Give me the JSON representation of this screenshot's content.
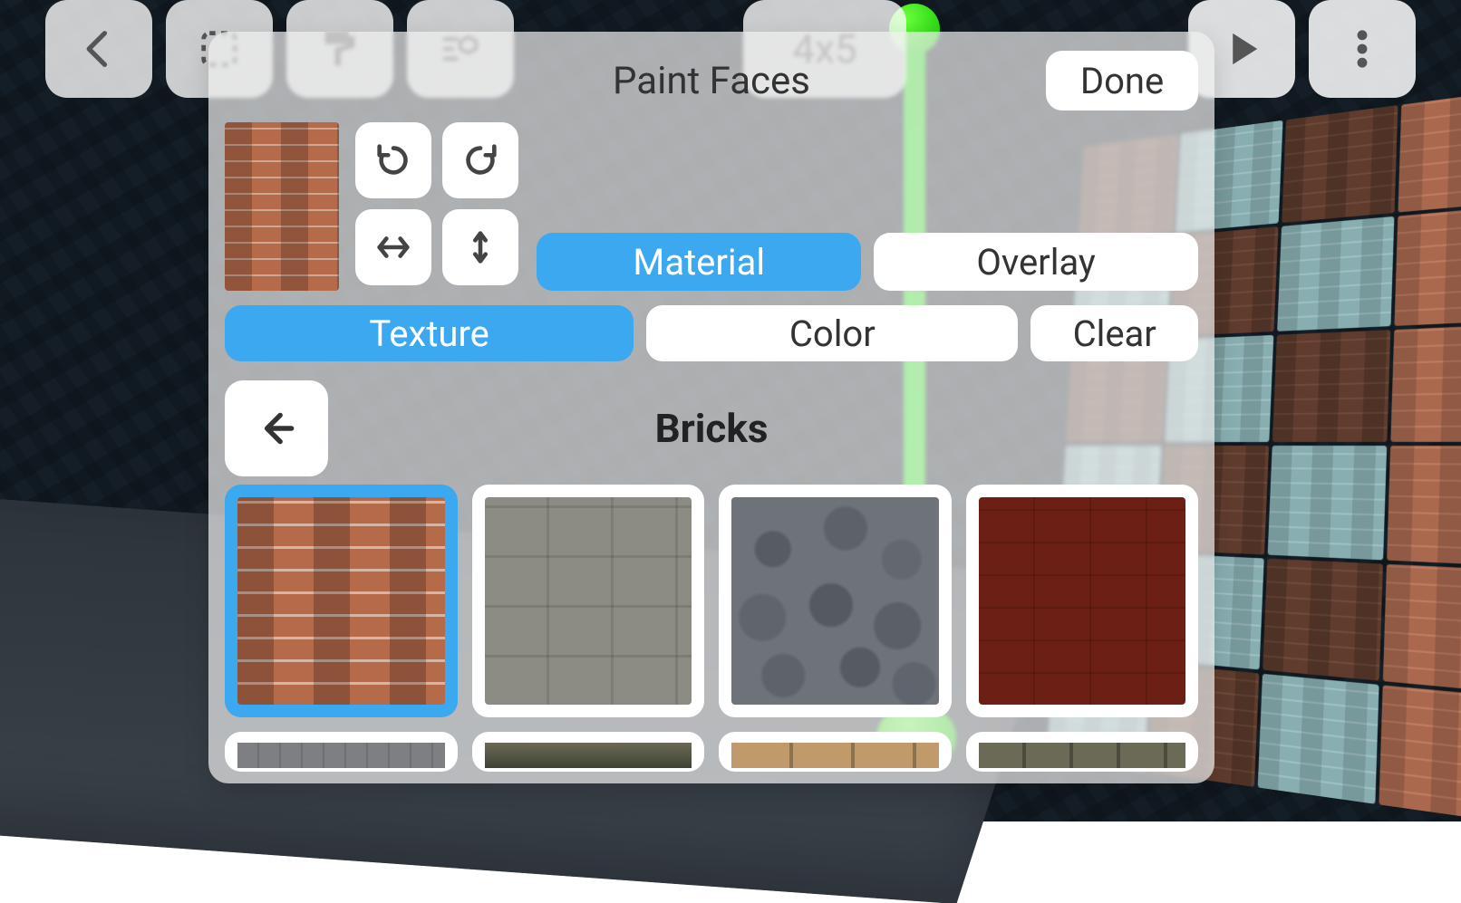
{
  "toolbar": {
    "size_label": "4x5",
    "icons": [
      "back-icon",
      "select-icon",
      "paint-icon",
      "object-settings-icon",
      "play-icon",
      "more-icon"
    ]
  },
  "sheet": {
    "title": "Paint Faces",
    "done_label": "Done",
    "transform_buttons": [
      "rotate-ccw-icon",
      "rotate-cw-icon",
      "flip-horizontal-icon",
      "flip-vertical-icon"
    ],
    "layer_tabs": {
      "items": [
        "Material",
        "Overlay"
      ],
      "active_index": 0
    },
    "mode_tabs": {
      "items": [
        "Texture",
        "Color",
        "Clear"
      ],
      "active_index": 0
    },
    "category": {
      "back_icon": "arrow-left-icon",
      "title": "Bricks"
    },
    "selected_texture_index": 0,
    "textures": [
      {
        "name": "red-brick",
        "selected": true
      },
      {
        "name": "grey-block",
        "selected": false
      },
      {
        "name": "rock-wall",
        "selected": false
      },
      {
        "name": "red-paver",
        "selected": false
      }
    ],
    "next_row_previews": [
      "cobble-small",
      "moss-brick",
      "sand-block",
      "dark-brick"
    ]
  },
  "colors": {
    "accent": "#3ba8f0",
    "panel": "#f0f0f0",
    "text": "#333333"
  }
}
